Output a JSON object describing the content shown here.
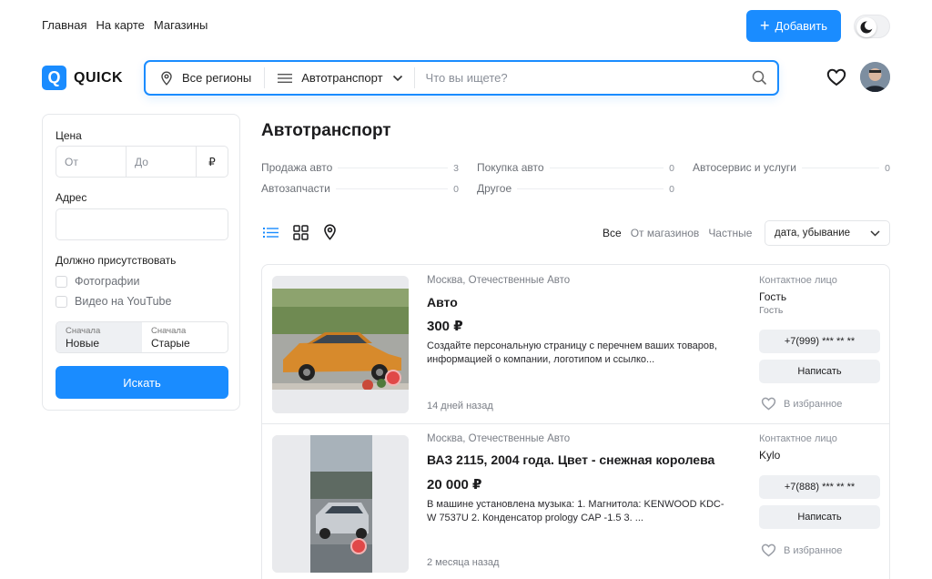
{
  "topnav": {
    "items": [
      "Главная",
      "На карте",
      "Магазины"
    ]
  },
  "header": {
    "add_label": "Добавить",
    "logo_text": "QUICK",
    "logo_letter": "Q"
  },
  "search": {
    "region": "Все регионы",
    "category": "Автотранспорт",
    "placeholder": "Что вы ищете?"
  },
  "sidebar": {
    "price_label": "Цена",
    "price_from_placeholder": "От",
    "price_to_placeholder": "До",
    "currency": "₽",
    "address_label": "Адрес",
    "must_have_label": "Должно присутствовать",
    "checkboxes": [
      "Фотографии",
      "Видео на YouTube"
    ],
    "sort": {
      "first_small": "Сначала",
      "first_big": "Новые",
      "second_small": "Сначала",
      "second_big": "Старые"
    },
    "find_label": "Искать"
  },
  "main": {
    "title": "Автотранспорт",
    "subcategories": [
      {
        "name": "Продажа авто",
        "count": "3"
      },
      {
        "name": "Покупка авто",
        "count": "0"
      },
      {
        "name": "Автосервис и услуги",
        "count": "0"
      },
      {
        "name": "Автозапчасти",
        "count": "0"
      },
      {
        "name": "Другое",
        "count": "0"
      }
    ],
    "filters": [
      "Все",
      "От магазинов",
      "Частные"
    ],
    "sort_select": "дата, убывание"
  },
  "listings": [
    {
      "location": "Москва, Отечественные Авто",
      "title": "Авто",
      "price": "300 ₽",
      "description": "Создайте персональную страницу с перечнем ваших товаров, информацией о компании, логотипом и ссылко...",
      "date": "14 дней назад",
      "contact_label": "Контактное лицо",
      "contact_name": "Гость",
      "contact_sub": "Гость",
      "phone": "+7(999) *** ** **",
      "write_label": "Написать",
      "fav_label": "В избранное"
    },
    {
      "location": "Москва, Отечественные Авто",
      "title": "ВАЗ 2115, 2004 года. Цвет - снежная королева",
      "price": "20 000 ₽",
      "description": "В машине установлена музыка: 1. Магнитола: KENWOOD KDC-W 7537U 2. Конденсатор prology CAP -1.5 3. ...",
      "date": "2 месяца назад",
      "contact_label": "Контактное лицо",
      "contact_name": "Kylo",
      "contact_sub": "",
      "phone": "+7(888) *** ** **",
      "write_label": "Написать",
      "fav_label": "В избранное"
    }
  ],
  "colors": {
    "accent": "#1a8cff",
    "border": "#e6e8eb",
    "muted": "#7a7e86"
  },
  "icons": [
    "plus-icon",
    "moon-icon",
    "location-pin-icon",
    "list-icon",
    "chevron-down-icon",
    "search-icon",
    "heart-icon",
    "grid-icon",
    "map-pin-icon"
  ]
}
